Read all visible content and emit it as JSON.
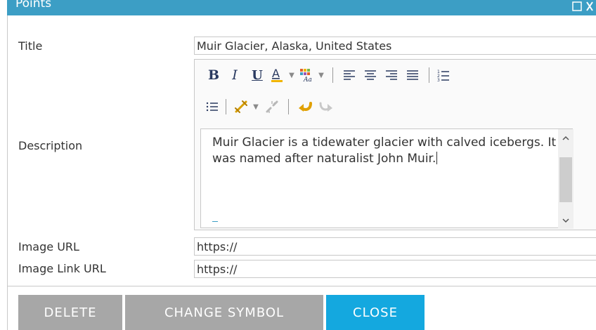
{
  "window": {
    "title": "Points",
    "maximize_icon": "maximize-icon",
    "close_icon": "close-icon"
  },
  "form": {
    "title_label": "Title",
    "title_value": "Muir Glacier, Alaska, United States",
    "description_label": "Description",
    "description_value": "Muir Glacier is a tidewater glacier with calved icebergs. It was named after naturalist John Muir.",
    "image_url_label": "Image URL",
    "image_url_value": "https://",
    "image_link_url_label": "Image Link URL",
    "image_link_url_value": "https://"
  },
  "toolbar": {
    "bold": "B",
    "italic": "I",
    "underline": "U",
    "font_color": "A",
    "icons": [
      "font-color-icon",
      "highlight-color-icon",
      "align-left-icon",
      "align-center-icon",
      "align-right-icon",
      "justify-icon",
      "ordered-list-icon",
      "unordered-list-icon",
      "link-icon",
      "unlink-icon",
      "undo-icon",
      "redo-icon"
    ]
  },
  "buttons": {
    "delete": "DELETE",
    "change_symbol": "CHANGE SYMBOL",
    "close": "CLOSE"
  },
  "colors": {
    "header": "#3c9ec5",
    "primary_button": "#14a8df",
    "secondary_button": "#a7a7a7"
  }
}
